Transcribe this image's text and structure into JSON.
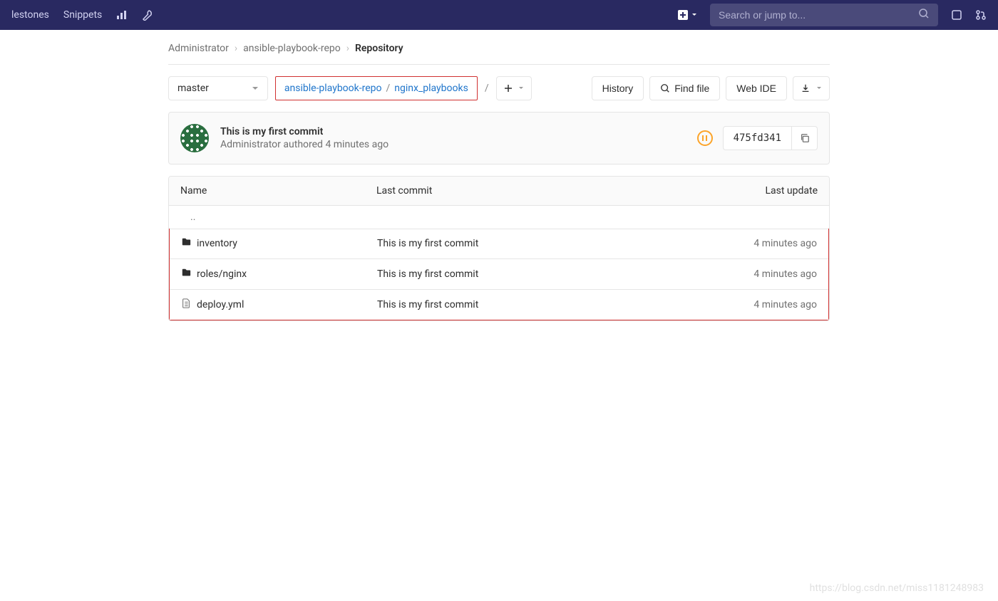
{
  "topnav": {
    "milestones": "lestones",
    "snippets": "Snippets",
    "search_placeholder": "Search or jump to..."
  },
  "breadcrumbs": {
    "admin": "Administrator",
    "repo": "ansible-playbook-repo",
    "current": "Repository"
  },
  "toolbar": {
    "branch": "master",
    "path_root": "ansible-playbook-repo",
    "path_sub": "nginx_playbooks",
    "history": "History",
    "find_file": "Find file",
    "web_ide": "Web IDE"
  },
  "commit": {
    "title": "This is my first commit",
    "author": "Administrator",
    "authored_text": "authored",
    "time": "4 minutes ago",
    "sha": "475fd341"
  },
  "table": {
    "headers": {
      "name": "Name",
      "commit": "Last commit",
      "update": "Last update"
    },
    "parent": "..",
    "rows": [
      {
        "type": "folder",
        "name": "inventory",
        "commit": "This is my first commit",
        "update": "4 minutes ago"
      },
      {
        "type": "folder",
        "name": "roles/nginx",
        "commit": "This is my first commit",
        "update": "4 minutes ago"
      },
      {
        "type": "file",
        "name": "deploy.yml",
        "commit": "This is my first commit",
        "update": "4 minutes ago"
      }
    ]
  },
  "watermark": "https://blog.csdn.net/miss1181248983"
}
